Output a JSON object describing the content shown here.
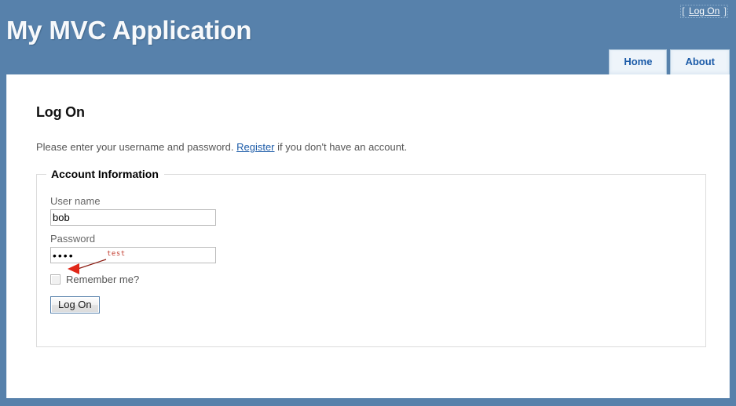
{
  "header": {
    "site_title": "My MVC Application",
    "logon_display": {
      "open_bracket": "[",
      "link_label": "Log On",
      "close_bracket": "]"
    },
    "menu": [
      {
        "label": "Home",
        "name": "home"
      },
      {
        "label": "About",
        "name": "about"
      }
    ]
  },
  "main": {
    "page_title": "Log On",
    "intro_prefix": "Please enter your username and password. ",
    "intro_link": "Register",
    "intro_suffix": " if you don't have an account.",
    "fieldset": {
      "legend": "Account Information",
      "username_label": "User name",
      "username_value": "bob",
      "username_placeholder": "",
      "password_label": "Password",
      "password_value": "••••",
      "password_placeholder": "",
      "remember_label": "Remember me?",
      "remember_checked": false,
      "submit_label": "Log On"
    }
  },
  "annotation": {
    "text": "test",
    "color": "#c0392b"
  },
  "colors": {
    "header_blue": "#5781ab",
    "link_blue": "#1c5ba8",
    "tab_background": "#eef4fa",
    "page_background": "#ffffff",
    "annotation_red": "#c0392b"
  }
}
